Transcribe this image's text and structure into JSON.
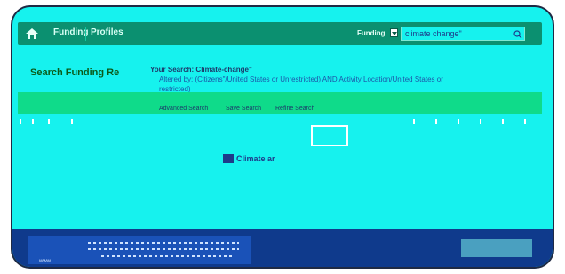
{
  "nav": {
    "home_icon": "home-icon",
    "items": [
      {
        "label": "Funding"
      },
      {
        "label": "Profiles"
      }
    ]
  },
  "search": {
    "scope": "Funding",
    "query": "climate change\"",
    "icon": "search-icon"
  },
  "results": {
    "sidebar_title": "Search Funding Re",
    "your_search": "Your Search: Climate-change\"",
    "filter_line": "Altered by: (Citizens\"/United States or Unrestricted) AND Activity Location/United States or",
    "filter_tail": "restricted)",
    "actions": [
      "Advanced Search",
      "Save Search",
      "Refine Search"
    ],
    "first_result_title": "Climate ar"
  },
  "footer": {
    "mark": "www"
  },
  "colors": {
    "nav_bg": "#0b9070",
    "page_bg": "#16f2ee",
    "accent_green": "#0fdb8a",
    "footer_blue": "#0f3a8c",
    "link_blue": "#1e3a8a"
  }
}
